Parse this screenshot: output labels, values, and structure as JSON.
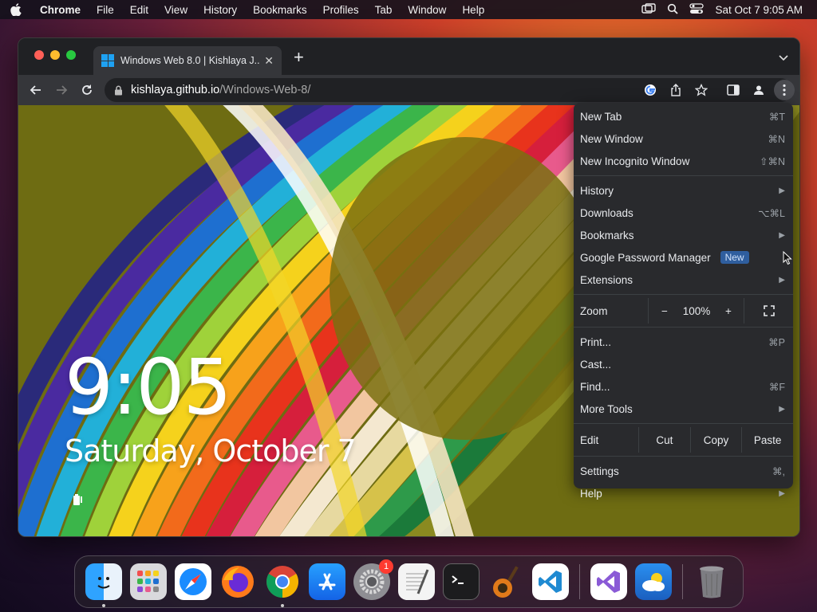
{
  "menubar": {
    "app_name": "Chrome",
    "items": [
      "File",
      "Edit",
      "View",
      "History",
      "Bookmarks",
      "Profiles",
      "Tab",
      "Window",
      "Help"
    ],
    "clock": "Sat Oct 7  9:05 AM"
  },
  "browser": {
    "tab_title": "Windows Web 8.0 | Kishlaya J...",
    "url_host": "kishlaya.github.io",
    "url_path": "/Windows-Web-8/"
  },
  "lockscreen": {
    "time": "9:05",
    "date": "Saturday, October 7"
  },
  "chrome_menu": {
    "new_tab": {
      "label": "New Tab",
      "shortcut": "⌘T"
    },
    "new_window": {
      "label": "New Window",
      "shortcut": "⌘N"
    },
    "new_incognito": {
      "label": "New Incognito Window",
      "shortcut": "⇧⌘N"
    },
    "history": {
      "label": "History"
    },
    "downloads": {
      "label": "Downloads",
      "shortcut": "⌥⌘L"
    },
    "bookmarks": {
      "label": "Bookmarks"
    },
    "password_manager": {
      "label": "Google Password Manager",
      "badge": "New"
    },
    "extensions": {
      "label": "Extensions"
    },
    "zoom": {
      "label": "Zoom",
      "minus": "−",
      "value": "100%",
      "plus": "+"
    },
    "print": {
      "label": "Print...",
      "shortcut": "⌘P"
    },
    "cast": {
      "label": "Cast..."
    },
    "find": {
      "label": "Find...",
      "shortcut": "⌘F"
    },
    "more_tools": {
      "label": "More Tools"
    },
    "edit": {
      "label": "Edit",
      "cut": "Cut",
      "copy": "Copy",
      "paste": "Paste"
    },
    "settings": {
      "label": "Settings",
      "shortcut": "⌘,"
    },
    "help": {
      "label": "Help"
    }
  },
  "dock": {
    "apps": [
      "finder",
      "launchpad",
      "safari",
      "firefox",
      "chrome",
      "app-store",
      "system-settings",
      "textedit",
      "terminal",
      "garageband",
      "vscode",
      "visual-studio",
      "weather",
      "trash"
    ],
    "system_settings_badge": "1"
  },
  "colors": {
    "chrome_dark": "#202124",
    "toolbar": "#35363a",
    "menu_bg": "#292a2d",
    "badge_blue": "#2f5e9e"
  }
}
